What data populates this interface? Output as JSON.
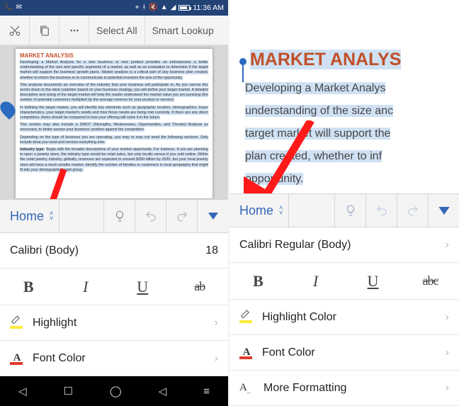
{
  "status": {
    "time": "11:36 AM"
  },
  "top_toolbar": {
    "select_all": "Select All",
    "smart_lookup": "Smart Lookup"
  },
  "document": {
    "title": "MARKET ANALYSIS",
    "p1": "Developing a Market Analysis for a new business or new product provides an entrepreneur a better understanding of the size and specific segments of a market, as well as an evaluation to determine if the target market will support the business' growth plans. Market analysis is a critical part of any business plan created, whether to inform the business or to communicate to potential investors the size of the opportunity.",
    "p2": "This analysis documents an overview of the industry that your business will participate in. As you narrow this sector down to the ideal customer based on your business strategy, you will define your target market. A detailed description and sizing of the target market will help the reader understand the market value you are pursuing (the number of potential customers multiplied by the average revenue for your product or service).",
    "p3": "In defining the target market, you will identify key elements such as geographic location, demographics, buyer characteristics, your target market's needs and how those needs are being met currently. If there are any direct competitors, these should be compared to how your offering will solve it in the future.",
    "p4": "This section may also include a SWOT (Strengths, Weaknesses, Opportunities, and Threats) Analysis as necessary, to better assess your business' position against the competition.",
    "p5": "Depending on the type of business you are operating, you may or may not need the following sections. Only include what you need and remove everything else.",
    "p6_head": "Industry type:",
    "p6": "Begin with the broader descriptions of your market opportunity. For instance, if you are planning to open a jewelry store, the industry type would be retail sales, but only locally versus if you sold online. Within the retail jewelry industry, globally, revenues are expected to exceed $250 billion by 2020, but your local jewelry store will have a much smaller market. Identify the number of families or customers in local geography that might fit into your demographic target group."
  },
  "right_doc": {
    "title": "MARKET ANALYS",
    "l1": "Developing a Market Analys",
    "l2": "understanding of the size anc",
    "l3": "target market will support the",
    "l4": "plan created, whether to inf",
    "l5": "opportunity."
  },
  "ribbon": {
    "tab": "Home",
    "font_left": "Calibri (Body)",
    "font_right": "Calibri Regular (Body)",
    "font_size": "18",
    "bold": "B",
    "italic": "I",
    "underline": "U",
    "strike_left": "ab",
    "strike_right": "abc",
    "highlight_left": "Highlight",
    "highlight_right": "Highlight Color",
    "font_color": "Font Color",
    "more_formatting": "More Formatting"
  }
}
